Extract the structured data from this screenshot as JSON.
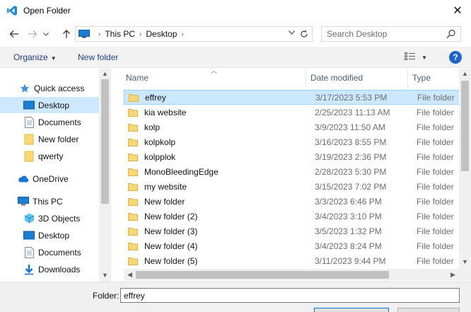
{
  "window": {
    "title": "Open Folder",
    "close_glyph": "✕"
  },
  "address": {
    "crumbs": [
      "This PC",
      "Desktop"
    ]
  },
  "search": {
    "placeholder": "Search Desktop"
  },
  "toolbar": {
    "organize": "Organize",
    "new_folder": "New folder",
    "help": "?"
  },
  "nav": {
    "quick_access": "Quick access",
    "items": [
      {
        "label": "Desktop",
        "icon": "desktop-icon",
        "selected": true
      },
      {
        "label": "Documents",
        "icon": "documents-icon"
      },
      {
        "label": "New folder",
        "icon": "folder-icon"
      },
      {
        "label": "qwerty",
        "icon": "folder-icon"
      }
    ],
    "onedrive": "OneDrive",
    "this_pc": "This PC",
    "pc_items": [
      {
        "label": "3D Objects",
        "icon": "3d-objects-icon"
      },
      {
        "label": "Desktop",
        "icon": "desktop-icon"
      },
      {
        "label": "Documents",
        "icon": "documents-icon"
      },
      {
        "label": "Downloads",
        "icon": "downloads-icon"
      }
    ]
  },
  "columns": {
    "name": "Name",
    "date": "Date modified",
    "type": "Type"
  },
  "files": [
    {
      "name": "effrey",
      "date": "3/17/2023 5:53 PM",
      "type": "File folder",
      "selected": true
    },
    {
      "name": "kia website",
      "date": "2/25/2023 11:13 AM",
      "type": "File folder"
    },
    {
      "name": "kolp",
      "date": "3/9/2023 11:50 AM",
      "type": "File folder"
    },
    {
      "name": "kolpkolp",
      "date": "3/16/2023 8:55 PM",
      "type": "File folder"
    },
    {
      "name": "kolpplok",
      "date": "3/19/2023 2:36 PM",
      "type": "File folder"
    },
    {
      "name": "MonoBleedingEdge",
      "date": "2/28/2023 5:30 PM",
      "type": "File folder"
    },
    {
      "name": "my website",
      "date": "3/15/2023 7:02 PM",
      "type": "File folder"
    },
    {
      "name": "New folder",
      "date": "3/3/2023 6:46 PM",
      "type": "File folder"
    },
    {
      "name": "New folder (2)",
      "date": "3/4/2023 3:10 PM",
      "type": "File folder"
    },
    {
      "name": "New folder (3)",
      "date": "3/5/2023 1:32 PM",
      "type": "File folder"
    },
    {
      "name": "New folder (4)",
      "date": "3/4/2023 8:24 PM",
      "type": "File folder"
    },
    {
      "name": "New folder (5)",
      "date": "3/11/2023 9:44 PM",
      "type": "File folder"
    }
  ],
  "footer": {
    "folder_label": "Folder:",
    "folder_value": "effrey"
  },
  "colors": {
    "accent": "#0078d7",
    "selection": "#cce8ff",
    "folder": "#f8d775",
    "link": "#1f3f8f"
  }
}
